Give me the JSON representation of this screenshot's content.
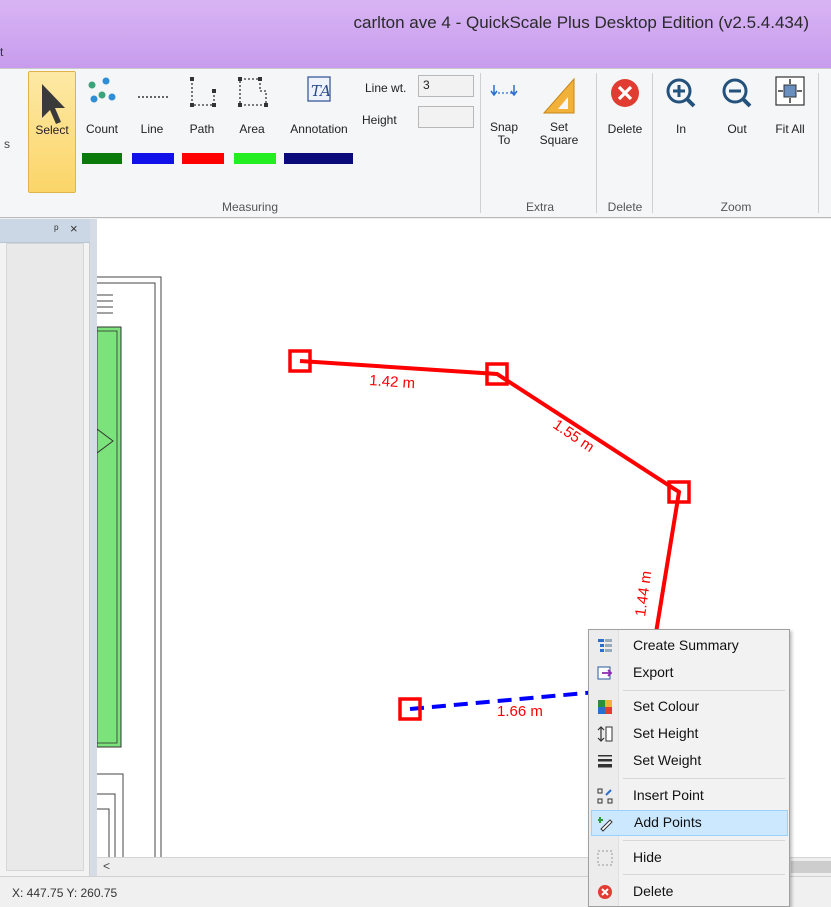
{
  "window": {
    "title": "carlton ave 4 - QuickScale Plus Desktop Edition (v2.5.4.434)",
    "left_fragment": "t"
  },
  "ribbon": {
    "measuring": {
      "tools": [
        {
          "id": "select",
          "label": "Select"
        },
        {
          "id": "count",
          "label": "Count"
        },
        {
          "id": "line",
          "label": "Line"
        },
        {
          "id": "path",
          "label": "Path"
        },
        {
          "id": "area",
          "label": "Area"
        },
        {
          "id": "annotation",
          "label": "Annotation"
        }
      ],
      "line_weight_label": "Line wt.",
      "line_weight_value": "3",
      "height_label": "Height",
      "height_value": "",
      "group_label": "Measuring",
      "colors": {
        "count": "#0a7a0a",
        "line": "#1010e8",
        "path": "#ff0000",
        "area": "#22ee22",
        "annotation": "#0a0a7a"
      }
    },
    "extra": {
      "snap_label_1": "Snap",
      "snap_label_2": "To",
      "square_label_1": "Set",
      "square_label_2": "Square",
      "group_label": "Extra"
    },
    "delete": {
      "label": "Delete",
      "group_label": "Delete"
    },
    "zoom": {
      "in_label": "In",
      "out_label": "Out",
      "fitall_label": "Fit All",
      "group_label": "Zoom"
    },
    "left_fragment": "s"
  },
  "left_panel": {
    "pin_glyph": "ᵖ",
    "close_glyph": "×"
  },
  "canvas": {
    "measurements": [
      {
        "label": "1.42 m",
        "color": "#ff0000"
      },
      {
        "label": "1.55 m",
        "color": "#ff0000"
      },
      {
        "label": "1.44 m",
        "color": "#ff0000"
      },
      {
        "label": "1.66 m",
        "color": "#0000ff"
      }
    ]
  },
  "scrollbar": {
    "left_arrow": "<"
  },
  "status": {
    "coords": "X: 447.75 Y: 260.75"
  },
  "context_menu": {
    "items": [
      {
        "label": "Create Summary",
        "icon": "summary-icon"
      },
      {
        "label": "Export",
        "icon": "export-icon"
      },
      {
        "label": "Set Colour",
        "icon": "colour-icon"
      },
      {
        "label": "Set Height",
        "icon": "height-icon"
      },
      {
        "label": "Set Weight",
        "icon": "weight-icon"
      },
      {
        "label": "Insert Point",
        "icon": "insert-point-icon"
      },
      {
        "label": "Add Points",
        "icon": "add-points-icon",
        "highlighted": true
      },
      {
        "label": "Hide",
        "icon": "hide-icon"
      },
      {
        "label": "Delete",
        "icon": "delete-icon"
      }
    ]
  }
}
